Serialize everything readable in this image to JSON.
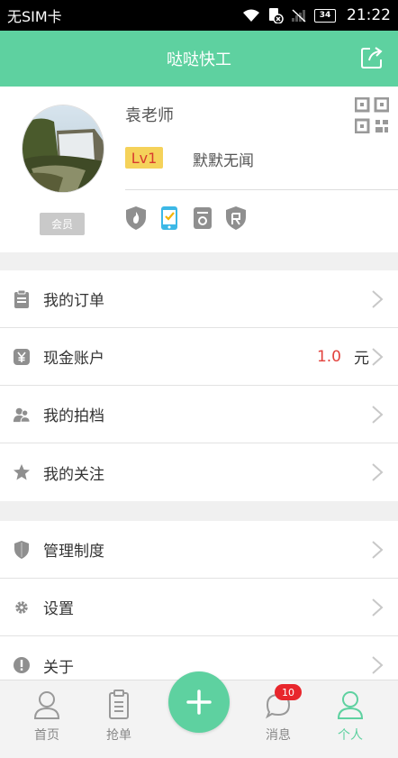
{
  "status_bar": {
    "carrier": "无SIM卡",
    "battery": "34",
    "time": "21:22"
  },
  "header": {
    "title": "哒哒快工",
    "share_icon": "share-icon"
  },
  "profile": {
    "name": "袁老师",
    "member_tag": "会员",
    "level": "Lv1",
    "level_desc": "默默无闻",
    "qr_icon": "qrcode-icon",
    "badges": [
      "fire-shield-icon",
      "phone-verified-icon",
      "id-card-icon",
      "guarantee-shield-icon"
    ]
  },
  "menu": {
    "group1": [
      {
        "label": "我的订单",
        "icon": "clipboard-icon"
      },
      {
        "label": "现金账户",
        "icon": "yuan-icon",
        "value": "1.0",
        "unit": "元"
      },
      {
        "label": "我的拍档",
        "icon": "partners-icon"
      },
      {
        "label": "我的关注",
        "icon": "star-icon"
      }
    ],
    "group2": [
      {
        "label": "管理制度",
        "icon": "shield-icon"
      },
      {
        "label": "设置",
        "icon": "gear-icon"
      },
      {
        "label": "关于",
        "icon": "info-icon"
      }
    ]
  },
  "bottom_nav": {
    "home": "首页",
    "grab": "抢单",
    "messages": "消息",
    "messages_badge": "10",
    "me": "个人"
  },
  "colors": {
    "accent": "#5ed1a0",
    "level_bg": "#f5d25a",
    "level_text": "#d83b2f",
    "amount": "#e2423d",
    "badge_red": "#e8262c"
  }
}
